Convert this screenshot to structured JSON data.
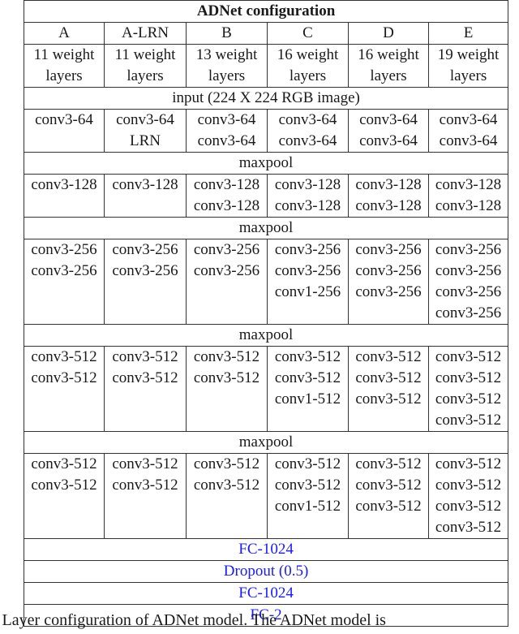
{
  "table": {
    "title": "ADNet configuration",
    "columns": [
      "A",
      "A-LRN",
      "B",
      "C",
      "D",
      "E"
    ],
    "weight_layers": [
      [
        "11 weight",
        "layers"
      ],
      [
        "11 weight",
        "layers"
      ],
      [
        "13 weight",
        "layers"
      ],
      [
        "16 weight",
        "layers"
      ],
      [
        "16 weight",
        "layers"
      ],
      [
        "19 weight",
        "layers"
      ]
    ],
    "input_row": "input (224 X 224 RGB image)",
    "blocks": [
      {
        "cells": [
          [
            "conv3-64"
          ],
          [
            "conv3-64",
            "LRN"
          ],
          [
            "conv3-64",
            "conv3-64"
          ],
          [
            "conv3-64",
            "conv3-64"
          ],
          [
            "conv3-64",
            "conv3-64"
          ],
          [
            "conv3-64",
            "conv3-64"
          ]
        ],
        "pool": "maxpool"
      },
      {
        "cells": [
          [
            "conv3-128"
          ],
          [
            "conv3-128"
          ],
          [
            "conv3-128",
            "conv3-128"
          ],
          [
            "conv3-128",
            "conv3-128"
          ],
          [
            "conv3-128",
            "conv3-128"
          ],
          [
            "conv3-128",
            "conv3-128"
          ]
        ],
        "pool": "maxpool"
      },
      {
        "cells": [
          [
            "conv3-256",
            "conv3-256"
          ],
          [
            "conv3-256",
            "conv3-256"
          ],
          [
            "conv3-256",
            "conv3-256"
          ],
          [
            "conv3-256",
            "conv3-256",
            "conv1-256"
          ],
          [
            "conv3-256",
            "conv3-256",
            "conv3-256"
          ],
          [
            "conv3-256",
            "conv3-256",
            "conv3-256",
            "conv3-256"
          ]
        ],
        "pool": "maxpool"
      },
      {
        "cells": [
          [
            "conv3-512",
            "conv3-512"
          ],
          [
            "conv3-512",
            "conv3-512"
          ],
          [
            "conv3-512",
            "conv3-512"
          ],
          [
            "conv3-512",
            "conv3-512",
            "conv1-512"
          ],
          [
            "conv3-512",
            "conv3-512",
            "conv3-512"
          ],
          [
            "conv3-512",
            "conv3-512",
            "conv3-512",
            "conv3-512"
          ]
        ],
        "pool": "maxpool"
      },
      {
        "cells": [
          [
            "conv3-512",
            "conv3-512"
          ],
          [
            "conv3-512",
            "conv3-512"
          ],
          [
            "conv3-512",
            "conv3-512"
          ],
          [
            "conv3-512",
            "conv3-512",
            "conv1-512"
          ],
          [
            "conv3-512",
            "conv3-512",
            "conv3-512"
          ],
          [
            "conv3-512",
            "conv3-512",
            "conv3-512",
            "conv3-512"
          ]
        ],
        "pool": null
      }
    ],
    "fc_layers": [
      "FC-1024",
      "Dropout (0.5)",
      "FC-1024",
      "FC-2"
    ],
    "fc_color": "#1a1aff"
  },
  "caption": ": Layer configuration of ADNet model. The ADNet model is"
}
